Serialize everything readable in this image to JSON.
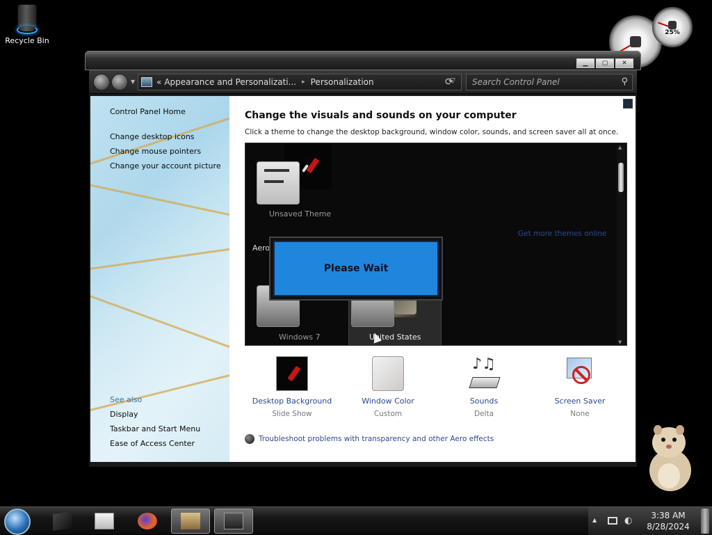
{
  "desktop": {
    "recycle_bin_label": "Recycle Bin",
    "gauge_percent": "25%"
  },
  "window": {
    "address": {
      "prefix": "«",
      "crumb1": "Appearance and Personalizati...",
      "separator": "▸",
      "crumb2": "Personalization"
    },
    "search_placeholder": "Search Control Panel",
    "sidebar": {
      "links": [
        "Control Panel Home",
        "Change desktop icons",
        "Change mouse pointers",
        "Change your account picture"
      ],
      "see_also_heading": "See also",
      "see_also": [
        "Display",
        "Taskbar and Start Menu",
        "Ease of Access Center"
      ]
    },
    "main": {
      "title": "Change the visuals and sounds on your computer",
      "subtitle": "Click a theme to change the desktop background, window color, sounds, and screen saver all at once.",
      "themes": {
        "unsaved_label": "Unsaved Theme",
        "get_more_link": "Get more themes online",
        "aero_heading": "Aero",
        "windows7_label": "Windows 7",
        "united_states_label": "United States"
      },
      "please_wait": "Please Wait",
      "settings": [
        {
          "label": "Desktop Background",
          "value": "Slide Show",
          "icon": "desktop-background-icon"
        },
        {
          "label": "Window Color",
          "value": "Custom",
          "icon": "window-color-icon"
        },
        {
          "label": "Sounds",
          "value": "Delta",
          "icon": "sounds-icon"
        },
        {
          "label": "Screen Saver",
          "value": "None",
          "icon": "screen-saver-icon"
        }
      ],
      "troubleshoot_link": "Troubleshoot problems with transparency and other Aero effects"
    }
  },
  "taskbar": {
    "time": "3:38 AM",
    "date": "8/28/2024",
    "apps": [
      "terminal-icon",
      "media-player-icon",
      "firefox-icon",
      "virtualbox-icon",
      "control-panel-icon"
    ]
  },
  "colors": {
    "link": "#2c4a8c",
    "please_wait_bg": "#1f86de",
    "slash_red": "#c41616"
  }
}
